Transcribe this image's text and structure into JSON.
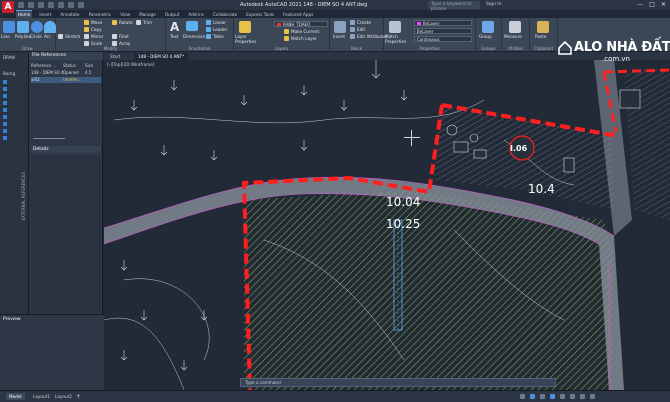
{
  "app": {
    "logo_letter": "A",
    "title": "Autodesk AutoCAD 2021    148 - DIEM SO 4 ANT.dwg",
    "search_placeholder": "Type a keyword or phrase",
    "user": "Sign In",
    "window_controls": [
      "—",
      "□",
      "✕"
    ]
  },
  "ribbon_tabs": [
    "Home",
    "Insert",
    "Annotate",
    "Parametric",
    "View",
    "Manage",
    "Output",
    "Add-ins",
    "Collaborate",
    "Express Tools",
    "Featured Apps"
  ],
  "ribbon": {
    "draw": {
      "label": "Draw",
      "line": "Line",
      "polyline": "Polyline",
      "circle": "Circle",
      "arc": "Arc"
    },
    "modify": {
      "label": "Modify",
      "items": [
        "Move",
        "Rotate",
        "Trim",
        "Copy",
        "Mirror",
        "Fillet",
        "Stretch",
        "Scale",
        "Array"
      ]
    },
    "annotation": {
      "label": "Annotation",
      "text": "Text",
      "dimension": "Dimension",
      "linear": "Linear",
      "leader": "Leader",
      "table": "Table"
    },
    "layers": {
      "label": "Layers",
      "layer_properties": "Layer Properties",
      "current_layer": "RANH_TDAEO",
      "make_current": "Make Current",
      "match_layer": "Match Layer"
    },
    "block": {
      "label": "Block",
      "insert": "Insert",
      "create": "Create",
      "edit": "Edit",
      "edit_attributes": "Edit Attributes"
    },
    "properties": {
      "label": "Properties",
      "match_properties": "Match Properties",
      "color": "ByLayer",
      "lineweight": "ByLayer",
      "linetype": "Continuous"
    },
    "groups": {
      "label": "Groups",
      "group": "Group"
    },
    "utilities": {
      "label": "Utilities",
      "measure": "Measure"
    },
    "clipboard": {
      "label": "Clipboard",
      "paste": "Paste"
    }
  },
  "left_strip": {
    "labels": [
      "DRAW",
      "Backg"
    ],
    "vertical": "EXTERNAL REFERENCES"
  },
  "xref_palette": {
    "title": "File References",
    "columns": [
      "Reference ...",
      "Status",
      "Size"
    ],
    "rows": [
      {
        "name": "148 - DIEM SO 4...",
        "status": "Opened",
        "size": "4.5"
      },
      {
        "name": "ai02",
        "status": "Unrefer...",
        "size": ""
      }
    ],
    "details_title": "Details"
  },
  "preview_title": "Preview",
  "doc_tabs": [
    "Start",
    "148 - DIEM SO 4 ANT*"
  ],
  "viewport_label": "[-][Top][2D Wireframe]",
  "drawing": {
    "labels": [
      "I.06",
      "10.4",
      "10.04",
      "10.25"
    ],
    "boundary_color": "#ff1f1f",
    "hatch_color": "#c8ff50",
    "road_color": "#8e96a2"
  },
  "command_line": "Type a command",
  "layout_tabs": [
    "Model",
    "Layout1",
    "Layout2"
  ],
  "watermark": {
    "brand": "ALO NHÀ ĐẤT",
    "domain": ".com.vn"
  }
}
